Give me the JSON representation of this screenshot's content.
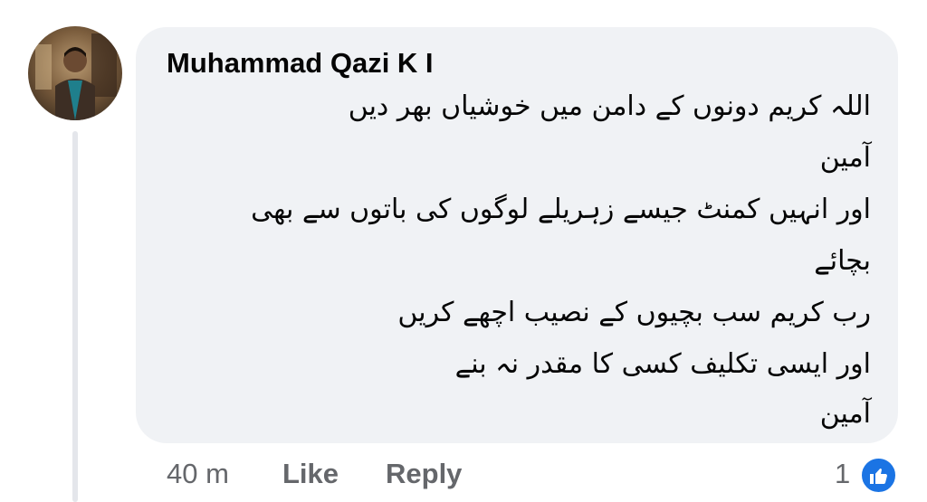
{
  "comment": {
    "author": "Muhammad Qazi K I",
    "lines": [
      "اللہ کریم دونوں کے دامن میں خوشیاں بھر دیں",
      "آمین",
      "اور انہیں کمنٹ جیسے زہریلے لوگوں کی باتوں سے بھی",
      "بچائے",
      "رب کریم سب بچیوں کے نصیب اچھے کریں",
      "اور ایسی تکلیف کسی کا مقدر نہ بنے",
      "آمین"
    ],
    "time": "40 m",
    "like_label": "Like",
    "reply_label": "Reply",
    "reaction_count": "1",
    "reaction_icon": "like-icon"
  },
  "colors": {
    "bubble": "#f0f2f5",
    "meta_text": "#65676b",
    "like_blue": "#1b74e4",
    "thread_line": "#e4e6eb"
  }
}
